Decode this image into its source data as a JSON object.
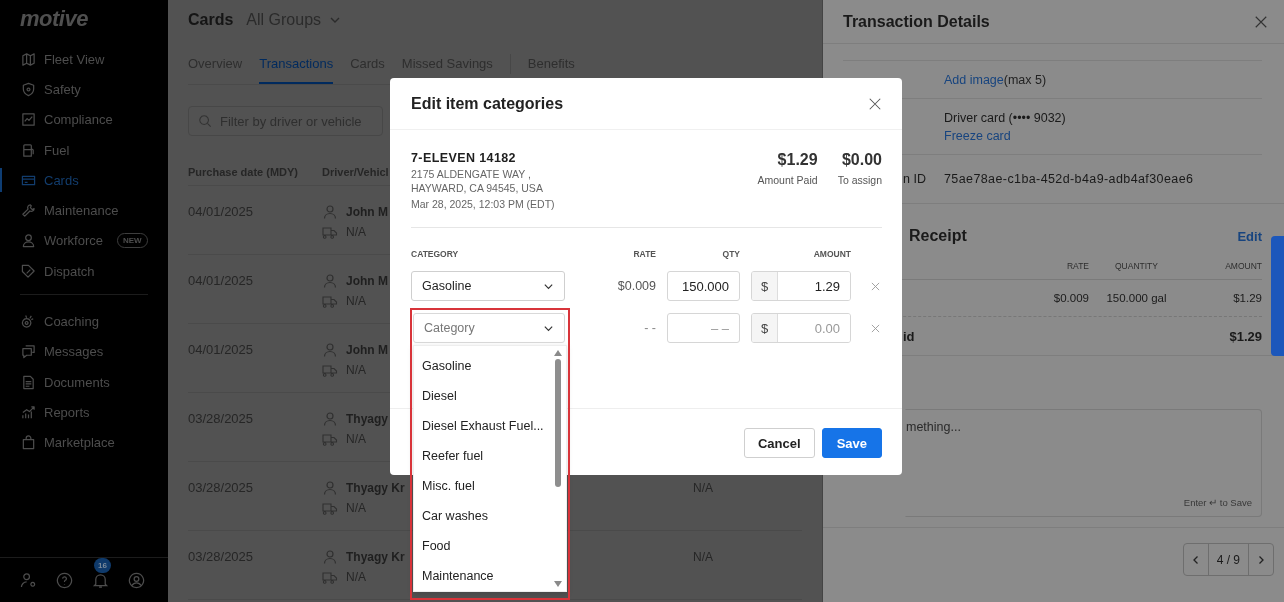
{
  "sidebar": {
    "logo": "motive",
    "sections": [
      {
        "items": [
          {
            "label": "Fleet View",
            "selected": false
          },
          {
            "label": "Safety",
            "selected": false
          },
          {
            "label": "Compliance",
            "selected": false
          },
          {
            "label": "Fuel",
            "selected": false
          },
          {
            "label": "Cards",
            "selected": true
          },
          {
            "label": "Maintenance",
            "selected": false
          },
          {
            "label": "Workforce",
            "selected": false,
            "badge": "NEW"
          },
          {
            "label": "Dispatch",
            "selected": false
          }
        ]
      },
      {
        "items": [
          {
            "label": "Coaching",
            "selected": false
          },
          {
            "label": "Messages",
            "selected": false
          },
          {
            "label": "Documents",
            "selected": false
          },
          {
            "label": "Reports",
            "selected": false
          },
          {
            "label": "Marketplace",
            "selected": false
          }
        ]
      }
    ],
    "notifications": "16"
  },
  "main": {
    "title": "Cards",
    "group": "All Groups",
    "tabs": [
      {
        "label": "Overview",
        "selected": false
      },
      {
        "label": "Transactions",
        "selected": true
      },
      {
        "label": "Cards",
        "selected": false
      },
      {
        "label": "Missed Savings",
        "selected": false
      },
      {
        "label": "Benefits",
        "selected": false
      }
    ],
    "search": {
      "placeholder": "Filter by driver or vehicle"
    },
    "table": {
      "columns": [
        "Purchase date (MDY)",
        "Driver/Vehicl"
      ],
      "rows": [
        {
          "date": "04/01/2025",
          "driver": "John M",
          "vehicle": "N/A"
        },
        {
          "date": "04/01/2025",
          "driver": "John M",
          "vehicle": "N/A"
        },
        {
          "date": "04/01/2025",
          "driver": "John M",
          "vehicle": "N/A"
        },
        {
          "date": "03/28/2025",
          "driver": "Thyagy",
          "vehicle": "N/A"
        },
        {
          "date": "03/28/2025",
          "driver": "Thyagy Kr",
          "vehicle": "N/A",
          "column_4": "N/A"
        },
        {
          "date": "03/28/2025",
          "driver": "Thyagy Kr",
          "vehicle": "N/A",
          "column_4": "N/A"
        }
      ]
    }
  },
  "details": {
    "title": "Transaction Details",
    "rows": [
      {
        "link": "Add image",
        "note": "(max 5)"
      },
      {
        "value": "Driver card (•••• 9032)",
        "link": "Freeze card"
      },
      {
        "label": "n ID",
        "value": "75ae78ae-c1ba-452d-b4a9-adb4af30eae6"
      }
    ],
    "receipt": {
      "title": "Receipt",
      "action": "Edit",
      "columns": [
        "RATE",
        "QUANTITY",
        "AMOUNT"
      ],
      "rows": [
        {
          "rate": "$0.009",
          "quantity": "150.000 gal",
          "amount": "$1.29"
        }
      ],
      "total": {
        "label": "id",
        "amount": "$1.29"
      }
    },
    "notes": {
      "placeholder": "mething...",
      "hint": "Enter ↵ to Save"
    },
    "pager": {
      "position": "4 / 9"
    }
  },
  "dialog": {
    "title": "Edit item categories",
    "merchant": {
      "name": "7-ELEVEN 14182",
      "address": [
        "2175 ALDENGATE WAY ,",
        "HAYWARD, CA 94545, USA"
      ],
      "time": "Mar 28, 2025, 12:03 PM (EDT)"
    },
    "summary": [
      {
        "amount": "$1.29",
        "label": "Amount Paid"
      },
      {
        "amount": "$0.00",
        "label": "To assign"
      }
    ],
    "columns": [
      "CATEGORY",
      "RATE",
      "QTY",
      "AMOUNT"
    ],
    "items": [
      {
        "category": "Gasoline",
        "rate": "$0.009",
        "qty": "150.000",
        "currency": "$",
        "amount": "1.29",
        "expanded": false
      },
      {
        "category_placeholder": "Category",
        "rate": "- -",
        "qty_placeholder": "– –",
        "currency": "$",
        "amount_placeholder": "0.00",
        "expanded": true,
        "highlighted": true,
        "options": [
          "Gasoline",
          "Diesel",
          "Diesel Exhaust Fuel...",
          "Reefer fuel",
          "Misc. fuel",
          "Car washes",
          "Food",
          "Maintenance"
        ]
      }
    ],
    "buttons": [
      {
        "label": "Cancel",
        "kind": "secondary"
      },
      {
        "label": "Save",
        "kind": "primary"
      }
    ]
  }
}
